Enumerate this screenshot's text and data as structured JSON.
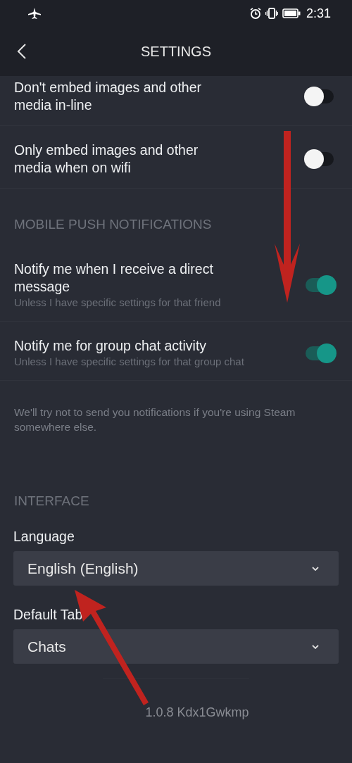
{
  "status_bar": {
    "time": "2:31"
  },
  "header": {
    "title": "SETTINGS"
  },
  "sections": [
    {
      "items": [
        {
          "label": "Don't embed images and other media in-line",
          "on": false
        },
        {
          "label": "Only embed images and other media when on wifi",
          "on": false
        }
      ]
    },
    {
      "heading": "MOBILE PUSH NOTIFICATIONS",
      "items": [
        {
          "label": "Notify me when I receive a direct message",
          "hint": "Unless I have specific settings for that friend",
          "on": true
        },
        {
          "label": "Notify me for group chat activity",
          "hint": "Unless I have specific settings for that group chat",
          "on": true
        }
      ],
      "note": "We'll try not to send you notifications if you're using Steam somewhere else."
    },
    {
      "heading": "INTERFACE",
      "selects": [
        {
          "label": "Language",
          "value": "English (English)"
        },
        {
          "label": "Default Tab",
          "value": "Chats"
        }
      ]
    }
  ],
  "version": "1.0.8 Kdx1Gwkmp"
}
